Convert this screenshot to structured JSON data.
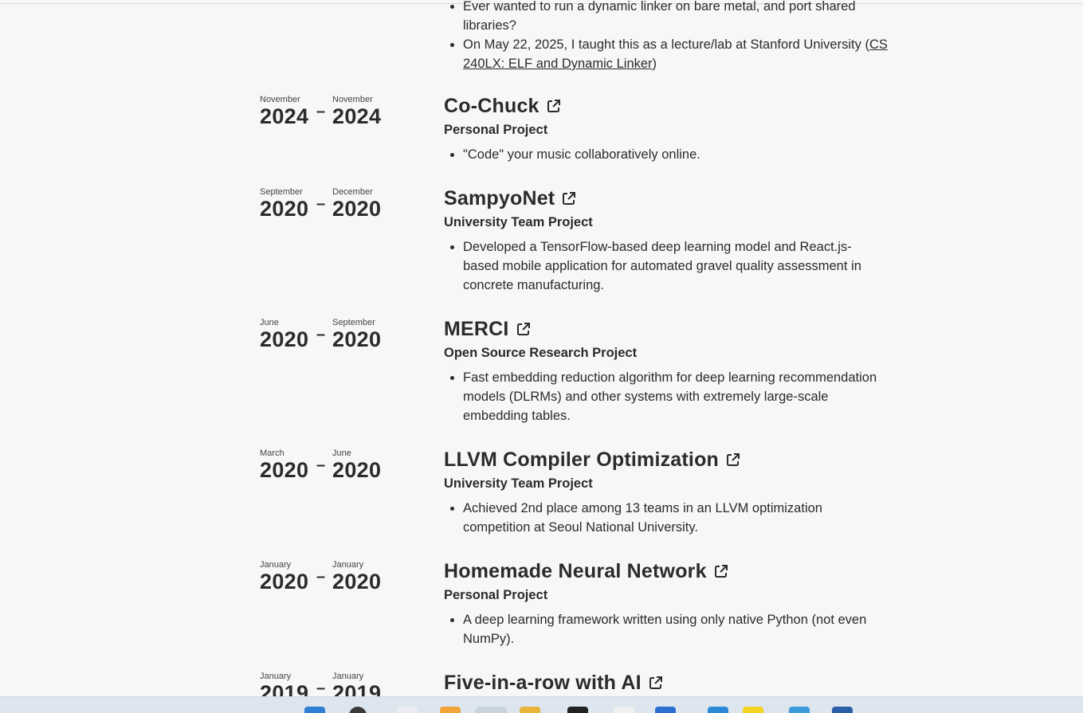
{
  "previous_entry": {
    "bullets": [
      "Ever wanted to run a dynamic linker on bare metal, and port shared libraries?",
      "On May 22, 2025, I taught this as a lecture/lab at Stanford University"
    ],
    "link_prefix": "(",
    "link_text": "CS 240LX: ELF and Dynamic Linker",
    "link_suffix": ")"
  },
  "projects": [
    {
      "start_month": "November",
      "start_year": "2024",
      "end_month": "November",
      "end_year": "2024",
      "title": "Co-Chuck",
      "subtitle": "Personal Project",
      "bullets": [
        "\"Code\" your music collaboratively online."
      ]
    },
    {
      "start_month": "September",
      "start_year": "2020",
      "end_month": "December",
      "end_year": "2020",
      "title": "SampyoNet",
      "subtitle": "University Team Project",
      "bullets": [
        "Developed a TensorFlow-based deep learning model and React.js-based mobile application for automated gravel quality assessment in concrete manufacturing."
      ]
    },
    {
      "start_month": "June",
      "start_year": "2020",
      "end_month": "September",
      "end_year": "2020",
      "title": "MERCI",
      "subtitle": "Open Source Research Project",
      "bullets": [
        "Fast embedding reduction algorithm for deep learning recommendation models (DLRMs) and other systems with extremely large-scale embedding tables."
      ]
    },
    {
      "start_month": "March",
      "start_year": "2020",
      "end_month": "June",
      "end_year": "2020",
      "title": "LLVM Compiler Optimization",
      "subtitle": "University Team Project",
      "bullets": [
        "Achieved 2nd place among 13 teams in an LLVM optimization competition at Seoul National University."
      ]
    },
    {
      "start_month": "January",
      "start_year": "2020",
      "end_month": "January",
      "end_year": "2020",
      "title": "Homemade Neural Network",
      "subtitle": "Personal Project",
      "bullets": [
        "A deep learning framework written using only native Python (not even NumPy)."
      ]
    },
    {
      "start_month": "January",
      "start_year": "2019",
      "end_month": "January",
      "end_year": "2019",
      "title": "Five-in-a-row with AI",
      "subtitle": "",
      "bullets": []
    }
  ],
  "date_separator": "–",
  "colors": {
    "background": "#f7f7f7",
    "text": "#2b2b2b",
    "taskbar": "#dde6ee"
  },
  "icons": {
    "external_link": "external-link-icon"
  }
}
